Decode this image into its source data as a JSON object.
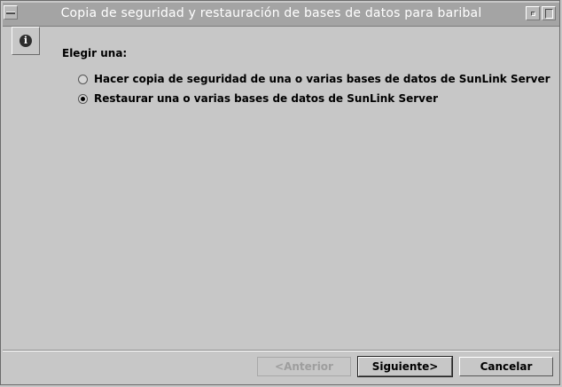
{
  "window": {
    "title": "Copia de seguridad y restauración de bases de datos para baribal"
  },
  "icons": {
    "info": "i"
  },
  "form": {
    "prompt": "Elegir una:",
    "options": [
      {
        "label": "Hacer copia de seguridad de una o varias bases de datos de SunLink Server",
        "selected": false
      },
      {
        "label": "Restaurar una o varias bases de datos de SunLink Server",
        "selected": true
      }
    ]
  },
  "buttons": {
    "previous": "<Anterior",
    "next": "Siguiente>",
    "cancel": "Cancelar"
  }
}
